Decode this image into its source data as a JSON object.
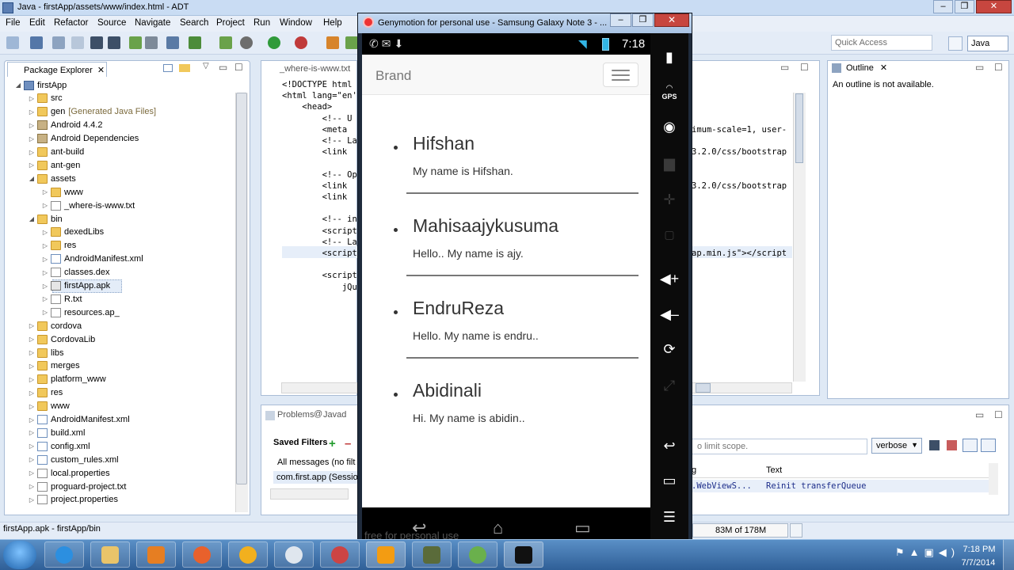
{
  "adt": {
    "title": "Java - firstApp/assets/www/index.html - ADT",
    "menu": [
      "File",
      "Edit",
      "Refactor",
      "Source",
      "Navigate",
      "Search",
      "Project",
      "Run",
      "Window",
      "Help"
    ],
    "quick_access_placeholder": "Quick Access",
    "perspective": "Java",
    "package_explorer": {
      "tab_label": "Package Explorer",
      "tree": [
        {
          "label": "firstApp",
          "depth": 0,
          "icon": "project-icon",
          "expanded": true
        },
        {
          "label": "src",
          "depth": 1,
          "icon": "folder-icon"
        },
        {
          "label": "gen",
          "note": "[Generated Java Files]",
          "depth": 1,
          "icon": "folder-icon"
        },
        {
          "label": "Android 4.4.2",
          "depth": 1,
          "icon": "library-icon"
        },
        {
          "label": "Android Dependencies",
          "depth": 1,
          "icon": "library-icon"
        },
        {
          "label": "ant-build",
          "depth": 1,
          "icon": "folder-icon"
        },
        {
          "label": "ant-gen",
          "depth": 1,
          "icon": "folder-icon"
        },
        {
          "label": "assets",
          "depth": 1,
          "icon": "folder-icon",
          "expanded": true
        },
        {
          "label": "www",
          "depth": 2,
          "icon": "folder-icon"
        },
        {
          "label": "_where-is-www.txt",
          "depth": 2,
          "icon": "file-icon"
        },
        {
          "label": "bin",
          "depth": 1,
          "icon": "folder-icon",
          "expanded": true
        },
        {
          "label": "dexedLibs",
          "depth": 2,
          "icon": "folder-icon"
        },
        {
          "label": "res",
          "depth": 2,
          "icon": "folder-icon"
        },
        {
          "label": "AndroidManifest.xml",
          "depth": 2,
          "icon": "xml-icon"
        },
        {
          "label": "classes.dex",
          "depth": 2,
          "icon": "file-icon"
        },
        {
          "label": "firstApp.apk",
          "depth": 2,
          "icon": "apk-icon",
          "selected": true
        },
        {
          "label": "R.txt",
          "depth": 2,
          "icon": "file-icon"
        },
        {
          "label": "resources.ap_",
          "depth": 2,
          "icon": "file-icon"
        },
        {
          "label": "cordova",
          "depth": 1,
          "icon": "folder-icon"
        },
        {
          "label": "CordovaLib",
          "depth": 1,
          "icon": "folder-icon"
        },
        {
          "label": "libs",
          "depth": 1,
          "icon": "folder-icon"
        },
        {
          "label": "merges",
          "depth": 1,
          "icon": "folder-icon"
        },
        {
          "label": "platform_www",
          "depth": 1,
          "icon": "folder-icon"
        },
        {
          "label": "res",
          "depth": 1,
          "icon": "folder-icon"
        },
        {
          "label": "www",
          "depth": 1,
          "icon": "folder-icon"
        },
        {
          "label": "AndroidManifest.xml",
          "depth": 1,
          "icon": "xml-icon"
        },
        {
          "label": "build.xml",
          "depth": 1,
          "icon": "xml-icon"
        },
        {
          "label": "config.xml",
          "depth": 1,
          "icon": "xml-icon"
        },
        {
          "label": "custom_rules.xml",
          "depth": 1,
          "icon": "xml-icon"
        },
        {
          "label": "local.properties",
          "depth": 1,
          "icon": "file-icon"
        },
        {
          "label": "proguard-project.txt",
          "depth": 1,
          "icon": "file-icon"
        },
        {
          "label": "project.properties",
          "depth": 1,
          "icon": "file-icon"
        }
      ]
    },
    "editor": {
      "tab_label": "_where-is-www.txt",
      "code_left": [
        "<!DOCTYPE html",
        "<html lang=\"en'",
        "    <head>",
        "        <!-- U",
        "        <meta",
        "        <!-- La",
        "        <link",
        "",
        "        <!-- Op",
        "        <link",
        "        <link",
        "",
        "        <!-- in",
        "        <script",
        "        <!-- La",
        "        <script",
        "",
        "        <script",
        "            jQu"
      ],
      "code_right": [
        "",
        "",
        "",
        "",
        "imum-scale=1, user-",
        "",
        "3.2.0/css/bootstrap",
        "",
        "",
        "3.2.0/css/bootstrap",
        "",
        "",
        "",
        "",
        "",
        "ap.min.js\"></script",
        "",
        "",
        ""
      ]
    },
    "outline": {
      "tab_label": "Outline",
      "message": "An outline is not available."
    },
    "bottom": {
      "problems_tab": "Problems",
      "javadoc_tab": "Javad",
      "saved_filters": "Saved Filters",
      "all_messages": "All messages (no filt",
      "filter_item": "com.first.app (Sessio",
      "search_placeholder": "o limit scope.",
      "level": "verbose",
      "col_tag": "g",
      "col_text": "Text",
      "log_tag": ".WebViewS...",
      "log_text": "Reinit transferQueue"
    },
    "status": {
      "selection": "firstApp.apk - firstApp/bin",
      "heap": "83M of 178M"
    }
  },
  "genymotion": {
    "title": "Genymotion for personal use - Samsung Galaxy Note 3 - ...",
    "time": "7:18",
    "watermark": "free for personal use",
    "app": {
      "brand": "Brand",
      "people": [
        {
          "name": "Hifshan",
          "desc": "My name is Hifshan."
        },
        {
          "name": "Mahisaajykusuma",
          "desc": "Hello.. My name is ajy."
        },
        {
          "name": "EndruReza",
          "desc": "Hello. My name is endru.."
        },
        {
          "name": "Abidinali",
          "desc": "Hi. My name is abidin.."
        }
      ]
    },
    "sidebar": {
      "gps_label": "GPS"
    }
  },
  "taskbar": {
    "time": "7:18 PM",
    "date": "7/7/2014"
  },
  "colors": {
    "android_accent": "#33b5e5",
    "close_red": "#c7463f"
  }
}
